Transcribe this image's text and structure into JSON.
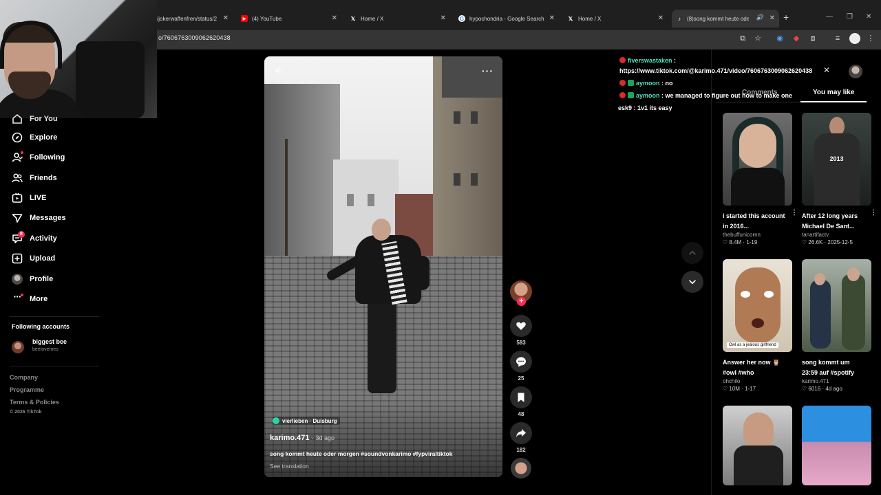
{
  "browser": {
    "tabs": [
      {
        "label": "/jokerwaffenfren/status/2",
        "favicon": "x-icon"
      },
      {
        "label": "(4) YouTube",
        "favicon": "youtube-icon"
      },
      {
        "label": "Home / X",
        "favicon": "x-icon"
      },
      {
        "label": "hypochondria - Google Search",
        "favicon": "google-icon"
      },
      {
        "label": "Home / X",
        "favicon": "x-icon"
      },
      {
        "label": "(8)song kommt heute oder",
        "favicon": "tiktok-icon",
        "active": true
      }
    ],
    "url": "o/7606763009062620438"
  },
  "sidebar": {
    "items": [
      {
        "label": "For You",
        "icon": "home-icon"
      },
      {
        "label": "Explore",
        "icon": "compass-icon"
      },
      {
        "label": "Following",
        "icon": "following-icon"
      },
      {
        "label": "Friends",
        "icon": "friends-icon"
      },
      {
        "label": "LIVE",
        "icon": "live-icon"
      },
      {
        "label": "Messages",
        "icon": "messages-icon"
      },
      {
        "label": "Activity",
        "icon": "activity-icon",
        "badge": "8"
      },
      {
        "label": "Upload",
        "icon": "upload-icon"
      },
      {
        "label": "Profile",
        "icon": "profile-avatar"
      },
      {
        "label": "More",
        "icon": "more-icon"
      }
    ],
    "following_title": "Following accounts",
    "accounts": [
      {
        "name": "biggest bee",
        "handle": "beelovemes"
      }
    ],
    "footer": [
      "Company",
      "Programme",
      "Terms & Policies"
    ],
    "copyright": "© 2026 TikTok"
  },
  "video": {
    "location": "vierlieben · Duisburg",
    "author": "karimo.471",
    "time": "· 3d ago",
    "caption": "song kommt heute oder morgen #soundvonkarimo #fypviraltiktok",
    "see_translation": "See translation",
    "actions": {
      "likes": "583",
      "comments": "25",
      "saves": "48",
      "shares": "182"
    }
  },
  "chat": [
    {
      "user": "fiverswastaken",
      "sep": " :",
      "message": ""
    },
    {
      "user": "",
      "sep": "",
      "message": "https://www.tiktok.com/@karimo.471/video/7606763009062620438"
    },
    {
      "user": "aymoon",
      "sep": " : ",
      "message": "no"
    },
    {
      "user": "aymoon",
      "sep": " : ",
      "message": "we managed to figure out how to make one"
    },
    {
      "user": "",
      "sep": "",
      "message": "esk9 : 1v1 its easy"
    }
  ],
  "panel": {
    "tab_comments": "Comments",
    "tab_you_may_like": "You may like",
    "cards": [
      {
        "title": "i started this account in 2016...",
        "author": "thebuffunicornn",
        "views": "8.4M",
        "date": "1-19"
      },
      {
        "title": "After 12 long years Michael De Sant...",
        "author": "tanartifactv",
        "views": "26.6K",
        "date": "2025-12-5",
        "overlay": "2013"
      },
      {
        "title": "Answer her now 🦉 #owl #who",
        "author": "ohchilo",
        "views": "10M",
        "date": "1-17",
        "overlay": "Owl as a jealous girlfriend"
      },
      {
        "title": "song kommt um 23:59 auf #spotify",
        "author": "karimo.471",
        "views": "6016",
        "date": "4d ago"
      }
    ]
  },
  "colors": {
    "accent": "#fe2c55",
    "chat_user": "#4ee2c0"
  }
}
